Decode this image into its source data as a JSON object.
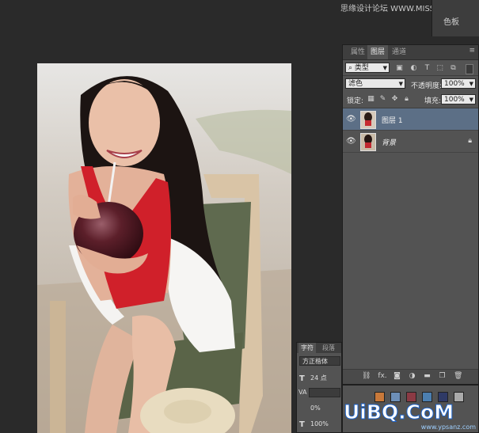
{
  "watermark_top": "思缘设计论坛 WWW.MISSYUAN.COM",
  "swatch_tab": {
    "label": "色板"
  },
  "layers_panel": {
    "tabs": [
      "属性",
      "图层",
      "通道"
    ],
    "menu_glyph": "≡",
    "filter": {
      "label": "类型",
      "search_glyph": "⌕"
    },
    "filter_icons": [
      "image-icon",
      "adjustment-icon",
      "type-icon",
      "shape-icon",
      "smart-object-icon",
      "toggle-icon"
    ],
    "blend_mode": "滤色",
    "opacity_label": "不透明度:",
    "opacity_value": "100%",
    "lock_label": "锁定:",
    "fill_label": "填充:",
    "fill_value": "100%",
    "layers": [
      {
        "name": "图层 1",
        "selected": true,
        "visible": true
      },
      {
        "name": "背景",
        "selected": false,
        "visible": true,
        "locked": true
      }
    ],
    "bottom_icons": [
      "link-icon",
      "fx-icon",
      "mask-icon",
      "adjustment-layer-icon",
      "group-icon",
      "new-layer-icon",
      "trash-icon"
    ],
    "bottom_fx": "fx."
  },
  "char_panel": {
    "tabs": [
      "字符",
      "段落"
    ],
    "font_family": "方正楷体",
    "font_size": "24 点",
    "tracking_label": "VA",
    "scale_label": "0%",
    "vscale": "100%",
    "t_glyph": "T"
  },
  "swatches": {
    "colors": [
      "#c9793a",
      "#6d8fb8",
      "#8b3a44",
      "#4c7fb0",
      "#2f3a66",
      "#aaaaaa"
    ]
  },
  "watermark_bottom": {
    "big": "UiBQ.CoM",
    "small": "www.ypsanz.com"
  },
  "colors": {
    "canvas_bg": "#2a2a2a",
    "panel": "#535353",
    "selected_layer": "#5c6f86"
  }
}
